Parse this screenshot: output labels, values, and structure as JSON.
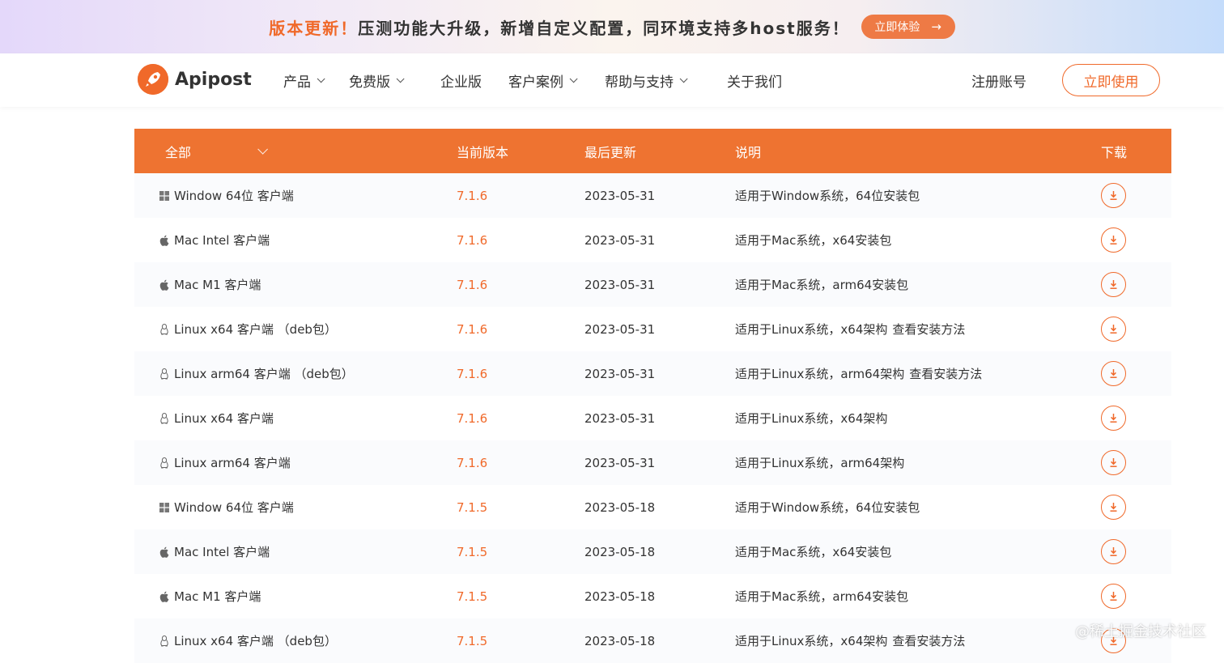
{
  "banner": {
    "highlight": "版本更新！",
    "text": "压测功能大升级，新增自定义配置，同环境支持多host服务！",
    "button_label": "立即体验",
    "button_arrow": "→"
  },
  "nav": {
    "brand": "Apipost",
    "items": [
      {
        "label": "产品",
        "dropdown": true
      },
      {
        "label": "免费版",
        "dropdown": true
      },
      {
        "label": "企业版",
        "dropdown": false
      },
      {
        "label": "客户案例",
        "dropdown": true
      },
      {
        "label": "帮助与支持",
        "dropdown": true
      },
      {
        "label": "关于我们",
        "dropdown": false
      }
    ],
    "signup": "注册账号",
    "cta": "立即使用"
  },
  "table": {
    "headers": {
      "filter": "全部",
      "version": "当前版本",
      "updated": "最后更新",
      "description": "说明",
      "download": "下载"
    },
    "rows": [
      {
        "os": "windows-icon",
        "name": "Window 64位 客户端",
        "version": "7.1.6",
        "date": "2023-05-31",
        "desc": "适用于Window系统，64位安装包",
        "link": ""
      },
      {
        "os": "apple-icon",
        "name": "Mac Intel 客户端",
        "version": "7.1.6",
        "date": "2023-05-31",
        "desc": "适用于Mac系统，x64安装包",
        "link": ""
      },
      {
        "os": "apple-icon",
        "name": "Mac M1 客户端",
        "version": "7.1.6",
        "date": "2023-05-31",
        "desc": "适用于Mac系统，arm64安装包",
        "link": ""
      },
      {
        "os": "linux-icon",
        "name": "Linux x64 客户端 （deb包）",
        "version": "7.1.6",
        "date": "2023-05-31",
        "desc": "适用于Linux系统，x64架构",
        "link": "查看安装方法"
      },
      {
        "os": "linux-icon",
        "name": "Linux arm64 客户端 （deb包）",
        "version": "7.1.6",
        "date": "2023-05-31",
        "desc": "适用于Linux系统，arm64架构",
        "link": "查看安装方法"
      },
      {
        "os": "linux-icon",
        "name": "Linux x64 客户端",
        "version": "7.1.6",
        "date": "2023-05-31",
        "desc": "适用于Linux系统，x64架构",
        "link": ""
      },
      {
        "os": "linux-icon",
        "name": "Linux arm64 客户端",
        "version": "7.1.6",
        "date": "2023-05-31",
        "desc": "适用于Linux系统，arm64架构",
        "link": ""
      },
      {
        "os": "windows-icon",
        "name": "Window 64位 客户端",
        "version": "7.1.5",
        "date": "2023-05-18",
        "desc": "适用于Window系统，64位安装包",
        "link": ""
      },
      {
        "os": "apple-icon",
        "name": "Mac Intel 客户端",
        "version": "7.1.5",
        "date": "2023-05-18",
        "desc": "适用于Mac系统，x64安装包",
        "link": ""
      },
      {
        "os": "apple-icon",
        "name": "Mac M1 客户端",
        "version": "7.1.5",
        "date": "2023-05-18",
        "desc": "适用于Mac系统，arm64安装包",
        "link": ""
      },
      {
        "os": "linux-icon",
        "name": "Linux x64 客户端 （deb包）",
        "version": "7.1.5",
        "date": "2023-05-18",
        "desc": "适用于Linux系统，x64架构",
        "link": "查看安装方法"
      }
    ]
  },
  "watermark": "@稀土掘金技术社区",
  "colors": {
    "accent": "#f0692a",
    "header_bg": "#ee7331"
  }
}
